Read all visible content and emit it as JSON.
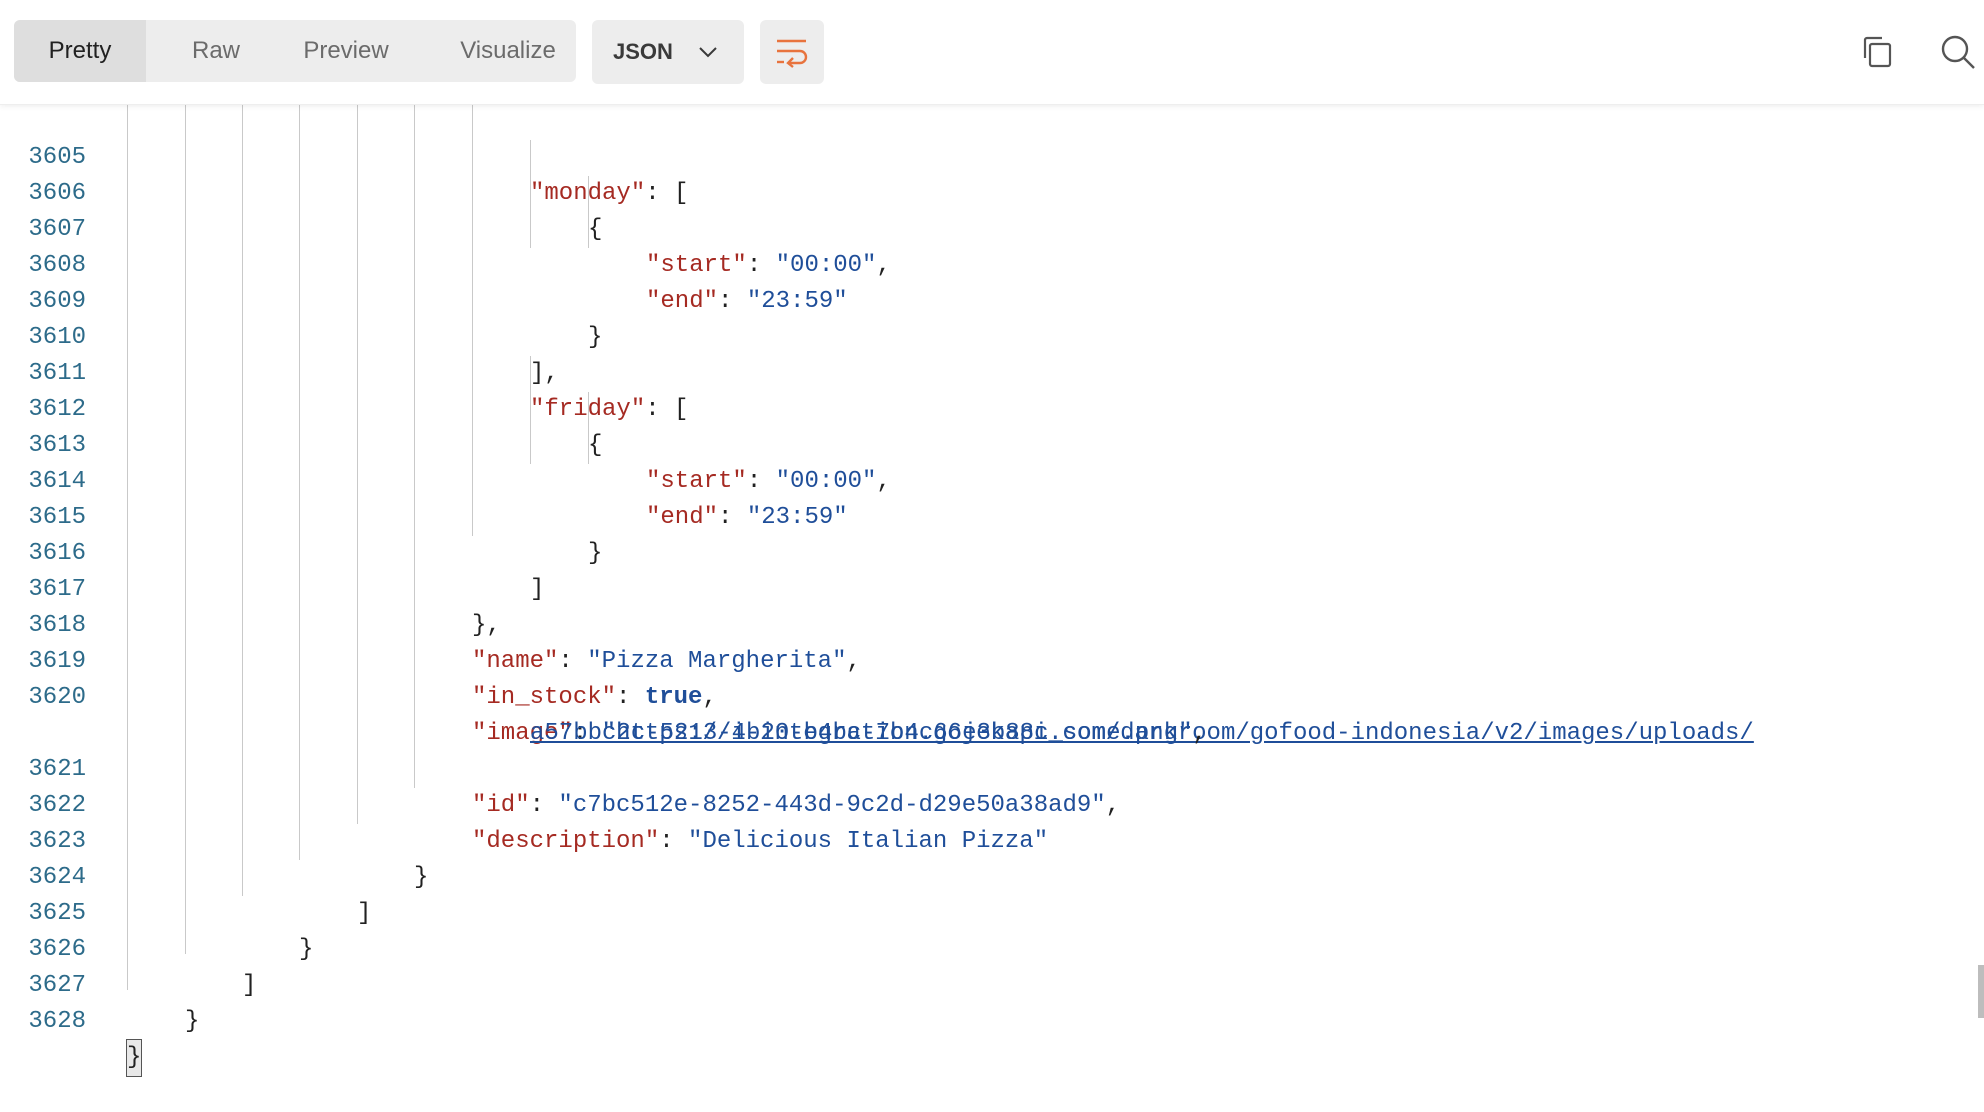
{
  "toolbar": {
    "tabs": [
      "Pretty",
      "Raw",
      "Preview",
      "Visualize"
    ],
    "active_tab": "Pretty",
    "format_selected": "JSON",
    "icons": {
      "wrap": "text-wrap-icon",
      "copy": "copy-icon",
      "search": "search-icon",
      "dropdown": "chevron-down-icon"
    }
  },
  "colors": {
    "accent": "#e8733d",
    "key": "#a52a22",
    "string": "#1f4e99",
    "line_number": "#2d6b8a"
  },
  "lines": {
    "l3605": {
      "n": "3605",
      "key": "\"monday\"",
      "after": ": ["
    },
    "l3606": {
      "n": "3606",
      "text": "{"
    },
    "l3607": {
      "n": "3607",
      "key": "\"start\"",
      "sep": ": ",
      "val": "\"00:00\"",
      "after": ","
    },
    "l3608": {
      "n": "3608",
      "key": "\"end\"",
      "sep": ": ",
      "val": "\"23:59\""
    },
    "l3609": {
      "n": "3609",
      "text": "}"
    },
    "l3610": {
      "n": "3610",
      "text": "],"
    },
    "l3611": {
      "n": "3611",
      "key": "\"friday\"",
      "after": ": ["
    },
    "l3612": {
      "n": "3612",
      "text": "{"
    },
    "l3613": {
      "n": "3613",
      "key": "\"start\"",
      "sep": ": ",
      "val": "\"00:00\"",
      "after": ","
    },
    "l3614": {
      "n": "3614",
      "key": "\"end\"",
      "sep": ": ",
      "val": "\"23:59\""
    },
    "l3615": {
      "n": "3615",
      "text": "}"
    },
    "l3616": {
      "n": "3616",
      "text": "]"
    },
    "l3617": {
      "n": "3617",
      "text": "},"
    },
    "l3618": {
      "n": "3618",
      "key": "\"name\"",
      "sep": ": ",
      "val": "\"Pizza Margherita\"",
      "after": ","
    },
    "l3619": {
      "n": "3619",
      "key": "\"in_stock\"",
      "sep": ": ",
      "val": "true",
      "after": ","
    },
    "l3620": {
      "n": "3620",
      "key": "\"image\"",
      "sep": ": ",
      "q1": "\"",
      "url1": "https://i-integration.gojekapi.com/darkroom/gofood-indonesia/v2/images/uploads/",
      "url2": "a57bbc2c-5213-4b20-b4bc-7b4c66e3b88c_some.png",
      "q2": "\"",
      "after": ","
    },
    "l3621": {
      "n": "3621",
      "key": "\"id\"",
      "sep": ": ",
      "val": "\"c7bc512e-8252-443d-9c2d-d29e50a38ad9\"",
      "after": ","
    },
    "l3622": {
      "n": "3622",
      "key": "\"description\"",
      "sep": ": ",
      "val": "\"Delicious Italian Pizza\""
    },
    "l3623": {
      "n": "3623",
      "text": "}"
    },
    "l3624": {
      "n": "3624",
      "text": "]"
    },
    "l3625": {
      "n": "3625",
      "text": "}"
    },
    "l3626": {
      "n": "3626",
      "text": "]"
    },
    "l3627": {
      "n": "3627",
      "text": "}"
    },
    "l3628": {
      "n": "3628",
      "text": "}"
    }
  }
}
